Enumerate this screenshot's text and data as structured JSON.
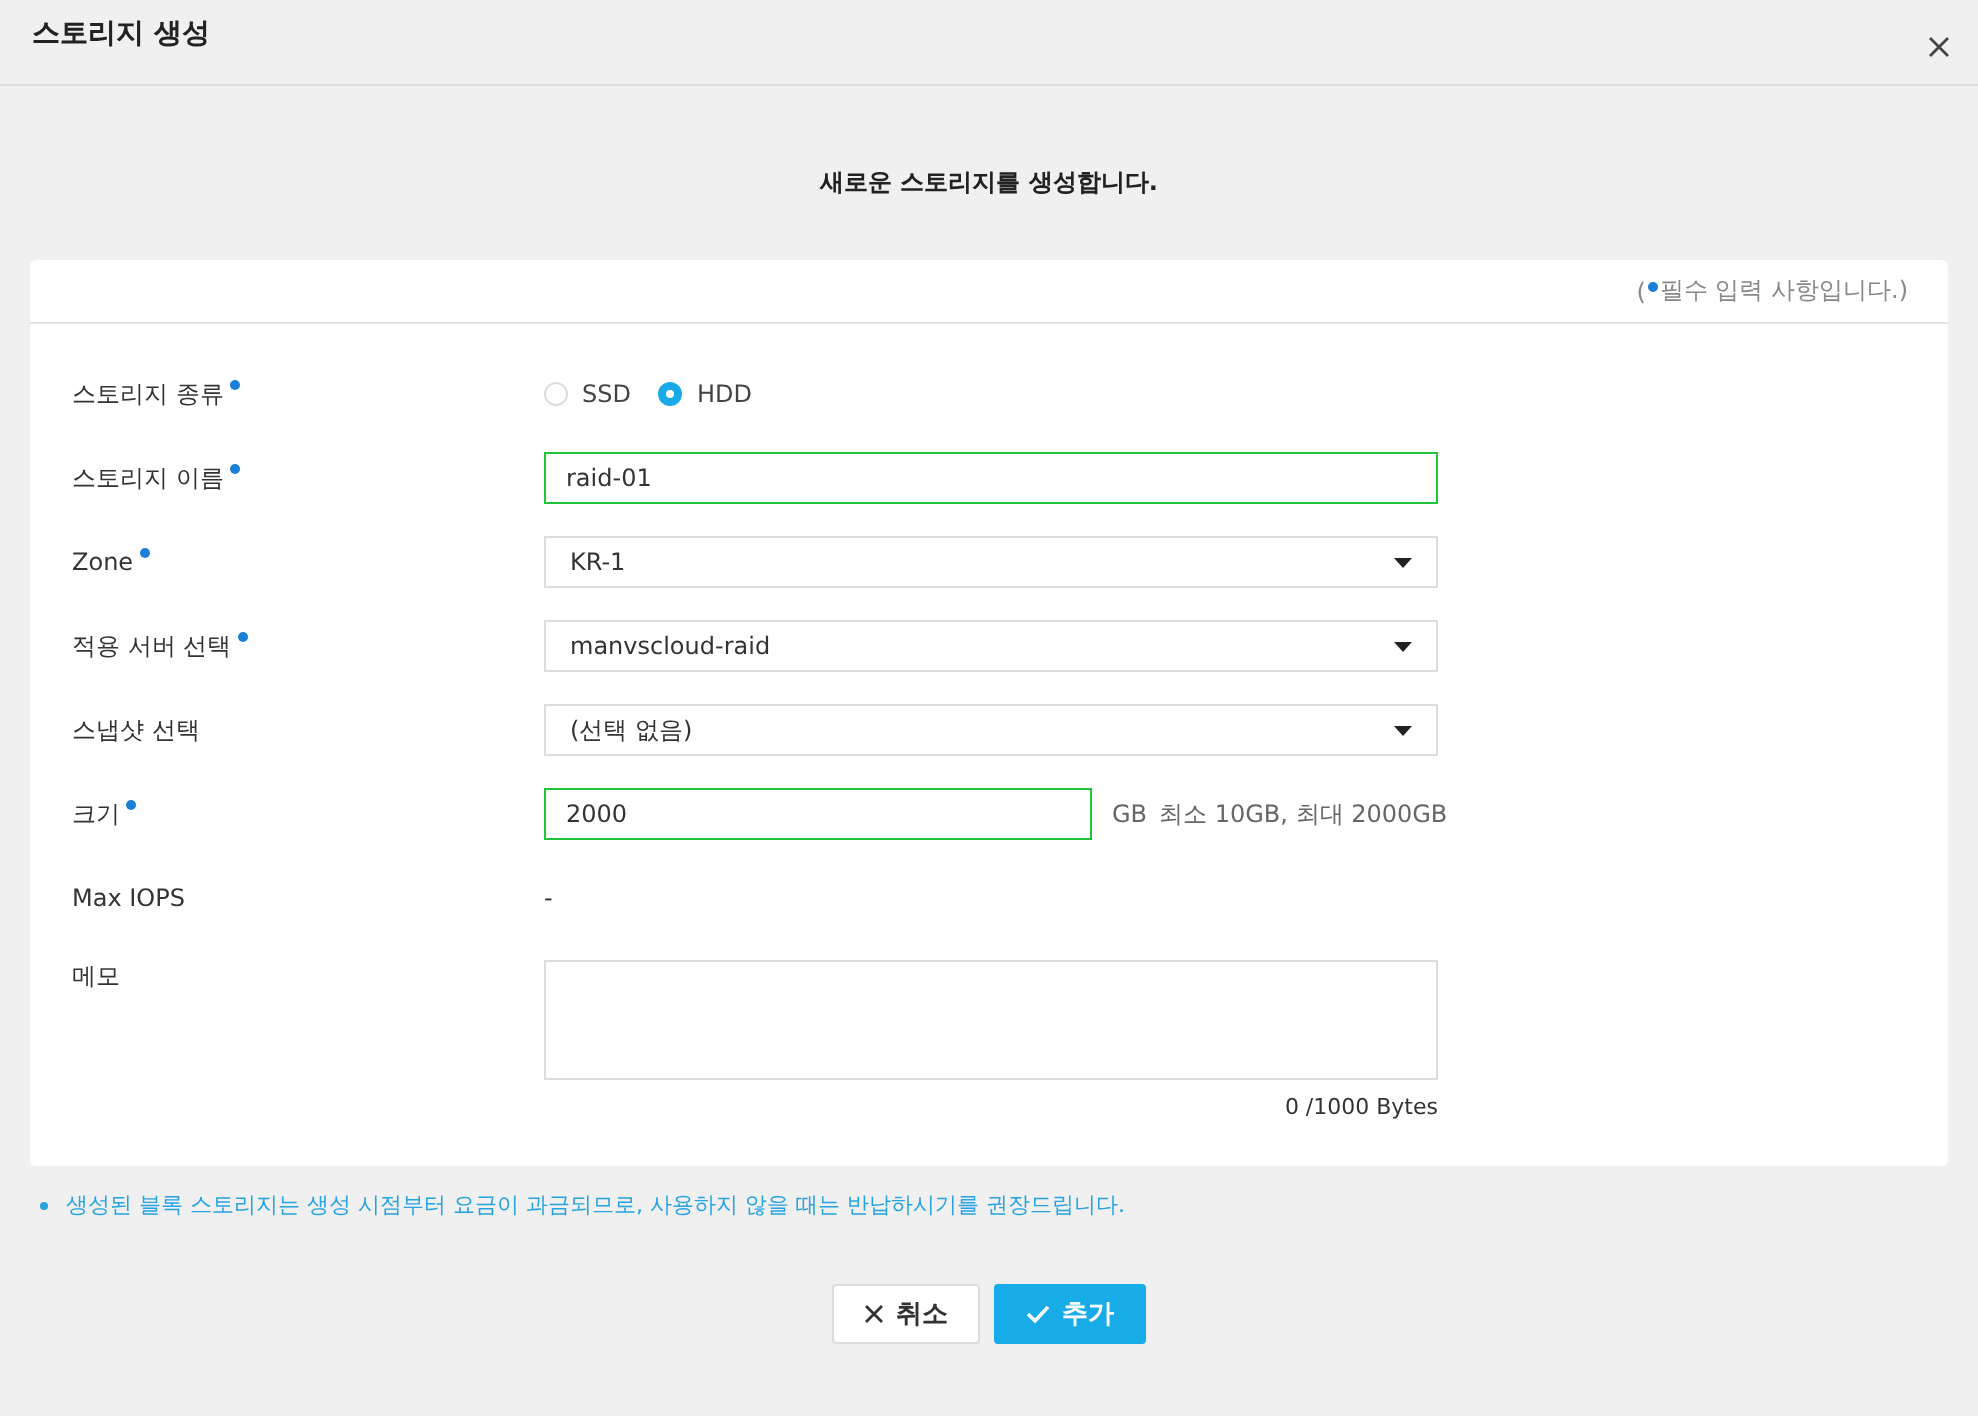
{
  "window": {
    "title": "스토리지 생성"
  },
  "subtitle": "새로운 스토리지를 생성합니다.",
  "required_note": {
    "prefix": "(",
    "text": "필수 입력 사항입니다.)"
  },
  "fields": [
    {
      "kind": "radio",
      "label": "스토리지 종류",
      "required": true,
      "options": [
        {
          "label": "SSD",
          "selected": false
        },
        {
          "label": "HDD",
          "selected": true
        }
      ]
    },
    {
      "kind": "text",
      "label": "스토리지 이름",
      "required": true,
      "value": "raid-01",
      "valid": true
    },
    {
      "kind": "select",
      "label": "Zone",
      "required": true,
      "value": "KR-1"
    },
    {
      "kind": "select",
      "label": "적용 서버 선택",
      "required": true,
      "value": "manvscloud-raid"
    },
    {
      "kind": "select",
      "label": "스냅샷 선택",
      "required": false,
      "value": "(선택 없음)"
    },
    {
      "kind": "size",
      "label": "크기",
      "required": true,
      "value": "2000",
      "valid": true,
      "unit": "GB",
      "hint": "최소 10GB, 최대 2000GB"
    },
    {
      "kind": "static",
      "label": "Max IOPS",
      "required": false,
      "value": "-"
    },
    {
      "kind": "textarea",
      "label": "메모",
      "required": false,
      "counter": "0 /1000 Bytes"
    }
  ],
  "notice": "생성된 블록 스토리지는 생성 시점부터 요금이 과금되므로, 사용하지 않을 때는 반납하시기를 권장드립니다.",
  "buttons": [
    {
      "kind": "cancel",
      "label": "취소"
    },
    {
      "kind": "confirm",
      "label": "추가"
    }
  ]
}
